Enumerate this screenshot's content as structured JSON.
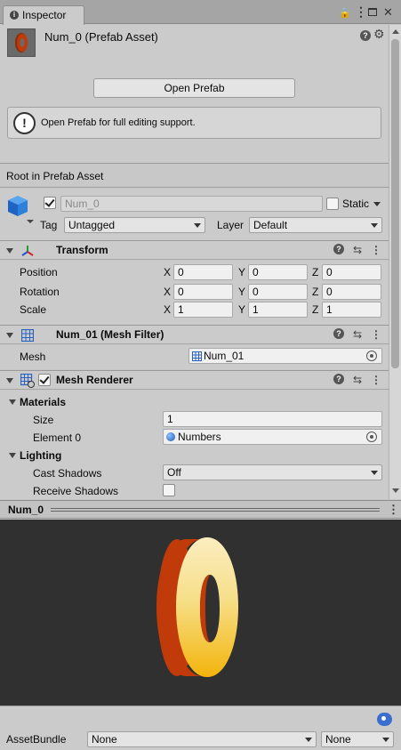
{
  "tab": {
    "label": "Inspector"
  },
  "asset": {
    "title": "Num_0 (Prefab Asset)"
  },
  "open_prefab": {
    "button_label": "Open Prefab",
    "info_text": "Open Prefab for full editing support."
  },
  "root_label": "Root in Prefab Asset",
  "gameobject": {
    "name": "Num_0",
    "active": true,
    "static_label": "Static",
    "tag_label": "Tag",
    "tag_value": "Untagged",
    "layer_label": "Layer",
    "layer_value": "Default"
  },
  "transform": {
    "title": "Transform",
    "rows": [
      {
        "label": "Position",
        "x": "0",
        "y": "0",
        "z": "0"
      },
      {
        "label": "Rotation",
        "x": "0",
        "y": "0",
        "z": "0"
      },
      {
        "label": "Scale",
        "x": "1",
        "y": "1",
        "z": "1"
      }
    ],
    "axis": {
      "x": "X",
      "y": "Y",
      "z": "Z"
    }
  },
  "mesh_filter": {
    "title": "Num_01 (Mesh Filter)",
    "mesh_label": "Mesh",
    "mesh_value": "Num_01"
  },
  "mesh_renderer": {
    "title": "Mesh Renderer",
    "enabled": true,
    "materials_label": "Materials",
    "size_label": "Size",
    "size_value": "1",
    "element_label": "Element 0",
    "element_value": "Numbers",
    "lighting_label": "Lighting",
    "cast_label": "Cast Shadows",
    "cast_value": "Off",
    "receive_label": "Receive Shadows"
  },
  "preview": {
    "title": "Num_0",
    "bg_color": "#303030"
  },
  "assetbundle": {
    "label": "AssetBundle",
    "name_value": "None",
    "variant_value": "None"
  },
  "colors": {
    "accent": "#3a6fcf",
    "digit_front": "#f6c94a",
    "digit_side": "#c03a0a"
  }
}
